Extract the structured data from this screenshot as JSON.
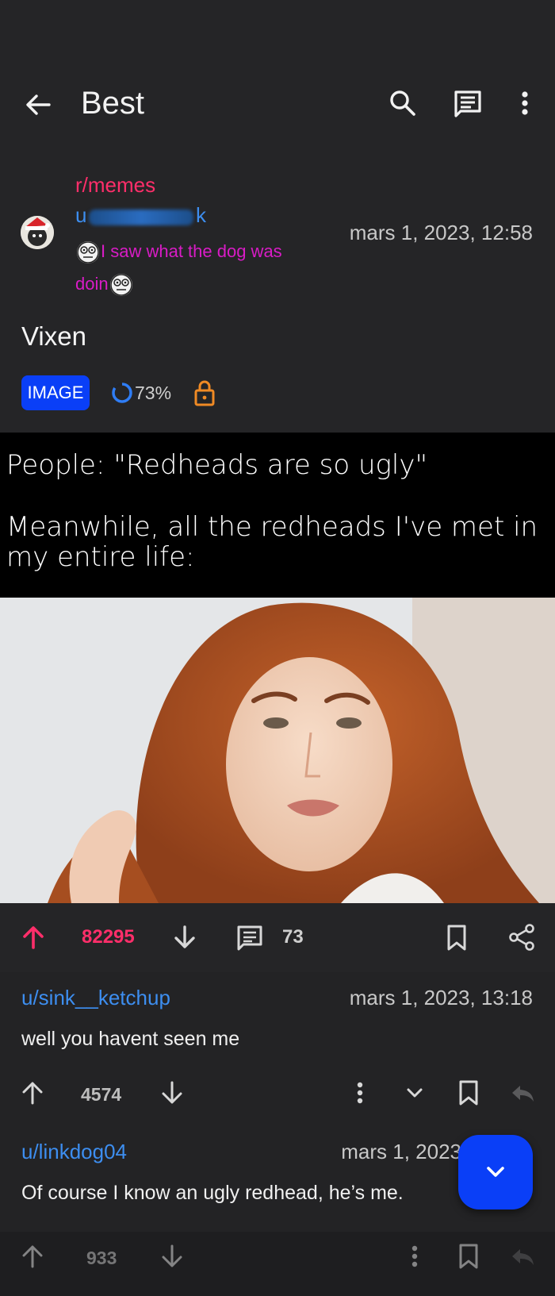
{
  "header": {
    "title": "Best"
  },
  "post": {
    "subreddit": "r/memes",
    "author_prefix": "u",
    "author_suffix": "k",
    "flair": "I saw what the dog was doin",
    "timestamp": "mars 1, 2023, 12:58",
    "title": "Vixen",
    "badge": "IMAGE",
    "upvote_ratio": "73%",
    "meme_caption_line1": "People: \"Redheads are so ugly\"",
    "meme_caption_line2": "Meanwhile, all the redheads I've met in my entire life:",
    "score": "82295",
    "comment_count": "73"
  },
  "comments": [
    {
      "author": "u/sink__ketchup",
      "timestamp": "mars 1, 2023, 13:18",
      "body": "well you havent seen me",
      "score": "4574"
    },
    {
      "author": "u/linkdog04",
      "timestamp": "mars 1, 2023",
      "body": "Of course I know an ugly redhead, he’s me.",
      "score": "933"
    }
  ],
  "colors": {
    "accent_upvote": "#ff2e6a",
    "link_blue": "#3d8ef0",
    "flair_magenta": "#d91cc6",
    "fab_blue": "#0a3ff7",
    "lock_orange": "#f08a24"
  }
}
